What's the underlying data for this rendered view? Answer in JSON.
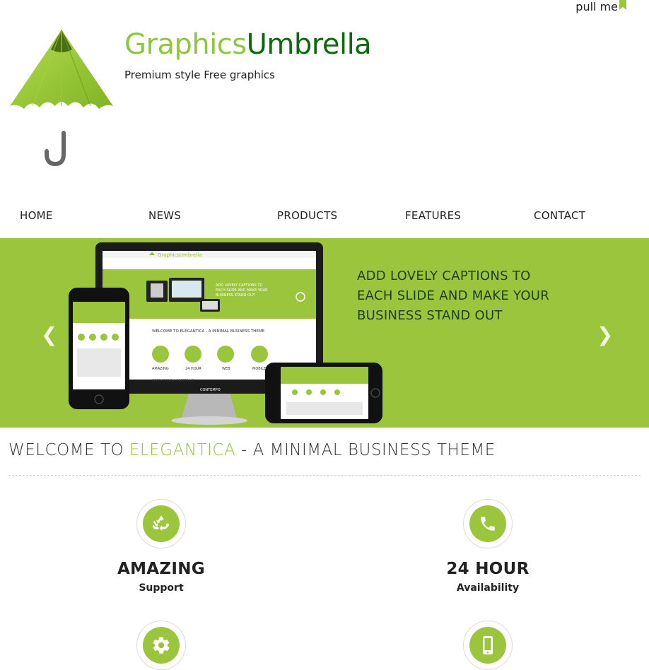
{
  "header": {
    "pull_label": "pull me",
    "brand_part1": "Graphics",
    "brand_part2": "Umbrella",
    "tagline": "Premium style Free graphics"
  },
  "nav": {
    "items": [
      {
        "label": "HOME"
      },
      {
        "label": "NEWS"
      },
      {
        "label": "PRODUCTS"
      },
      {
        "label": "FEATURES"
      },
      {
        "label": "CONTACT"
      }
    ]
  },
  "slider": {
    "caption": "ADD LOVELY CAPTIONS TO EACH SLIDE AND MAKE YOUR BUSINESS STAND OUT",
    "prev_icon": "chevron-left-icon",
    "next_icon": "chevron-right-icon",
    "screen_brand": "GraphicsUmbrella",
    "screen_tag": "Premium style Free graphics",
    "screen_welcome": "WELCOME TO ELEGANTICA - A MINIMAL BUSINESS THEME",
    "screen_features": [
      "AMAZING",
      "24 HOUR",
      "WEB",
      "MOBILE"
    ],
    "screen_feature_subs": [
      "Support",
      "Availability",
      "Design",
      "Development"
    ],
    "screen_recent": "RECENT FROM PORTFOLIO",
    "screen_stand": "CONTEMPO"
  },
  "welcome": {
    "prefix": "WELCOME TO ",
    "accent": "ELEGANTICA",
    "suffix": " - A MINIMAL BUSINESS THEME"
  },
  "features": [
    {
      "title": "AMAZING",
      "sub": "Support",
      "icon": "recycle-icon"
    },
    {
      "title": "24 HOUR",
      "sub": "Availability",
      "icon": "phone-icon"
    },
    {
      "title": "",
      "sub": "",
      "icon": "gear-icon"
    },
    {
      "title": "",
      "sub": "",
      "icon": "mobile-icon"
    }
  ],
  "colors": {
    "accent": "#9bc53d",
    "brand_light": "#8dc63f",
    "brand_dark": "#0b6b0b"
  }
}
